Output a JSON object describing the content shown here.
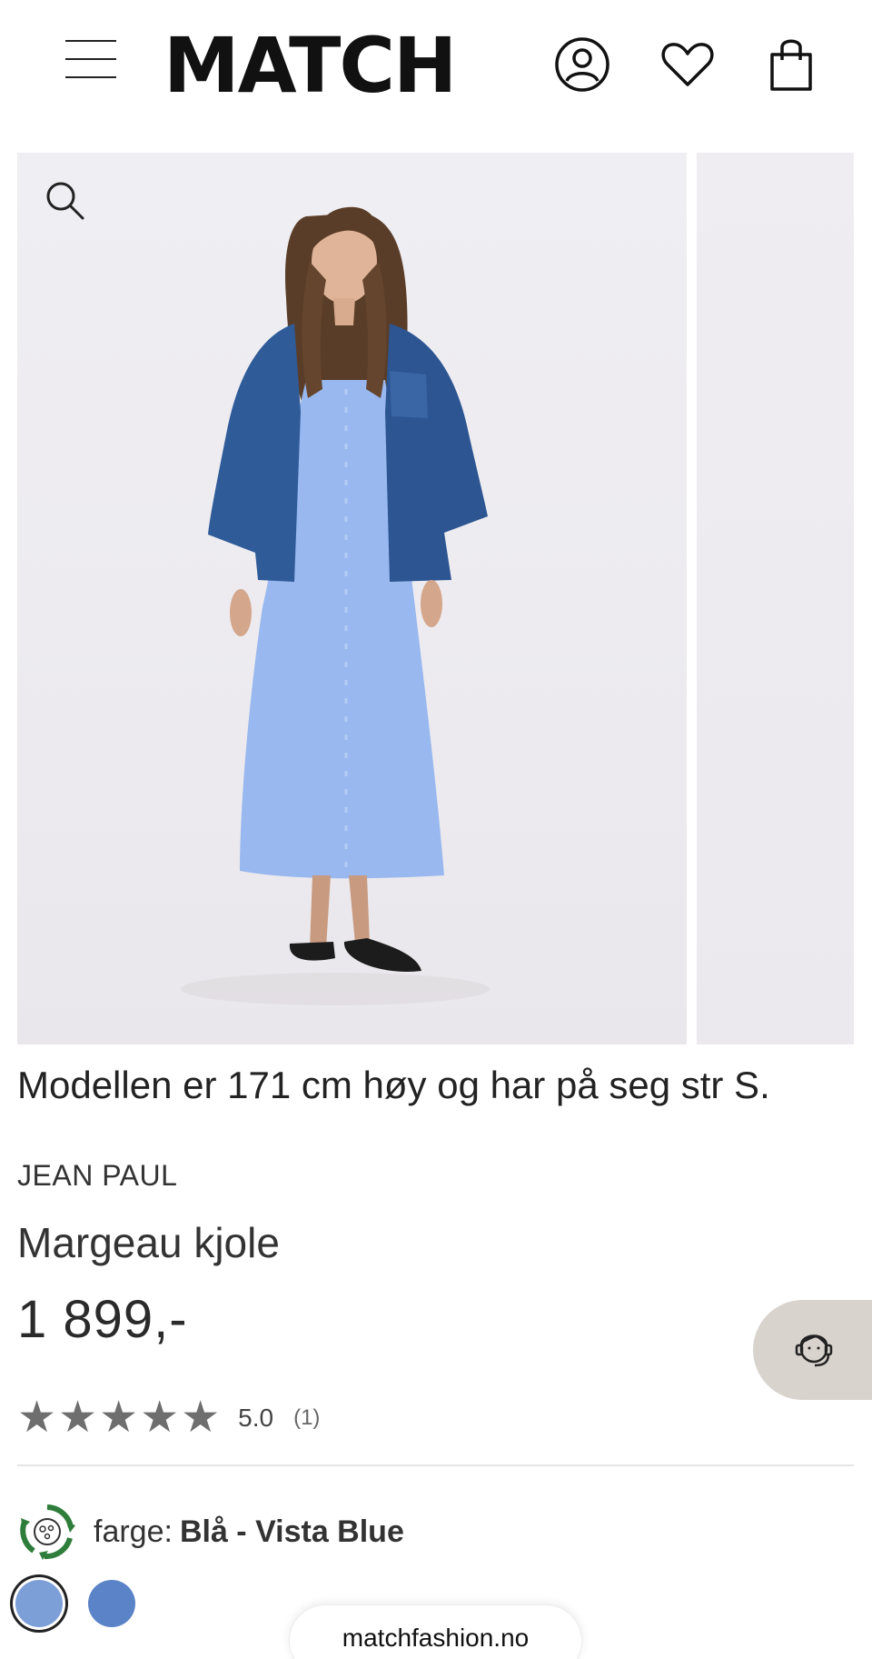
{
  "header": {
    "logo_text": "MATCH",
    "menu_icon": "hamburger-menu-icon",
    "account_icon": "user-icon",
    "wishlist_icon": "heart-icon",
    "cart_icon": "shopping-bag-icon"
  },
  "gallery": {
    "zoom_icon": "search-icon"
  },
  "product": {
    "model_note": "Modellen er 171 cm høy og har på seg str S.",
    "brand": "JEAN PAUL",
    "name": "Margeau kjole",
    "price": "1 899,-",
    "rating": {
      "stars": 5,
      "value": "5.0",
      "count": "(1)"
    },
    "color": {
      "label": "farge:",
      "value": "Blå - Vista Blue",
      "swatches": [
        "#7d9fd8",
        "#5a83c8"
      ]
    }
  },
  "support": {
    "chat_icon": "customer-service-icon"
  },
  "browser": {
    "url": "matchfashion.no"
  },
  "colors": {
    "rating_star": "#6e6e6e",
    "chat_bg": "#d9d3cd",
    "eco_green": "#2e7d3a"
  }
}
